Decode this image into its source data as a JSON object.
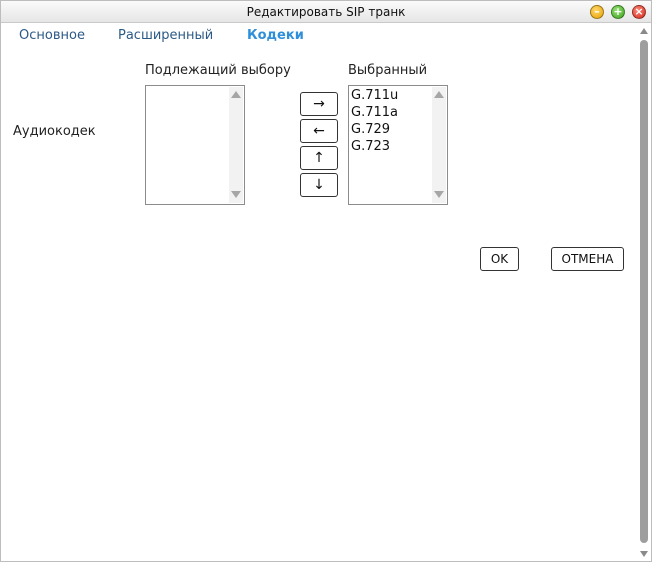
{
  "window": {
    "title": "Редактировать SIP транк",
    "controls": {
      "minimize": "–",
      "maximize": "+",
      "close": "×"
    }
  },
  "tabs": [
    {
      "label": "Основное",
      "active": false
    },
    {
      "label": "Расширенный",
      "active": false
    },
    {
      "label": "Кодеки",
      "active": true
    }
  ],
  "codecs": {
    "row_label": "Аудиокодек",
    "available_label": "Подлежащий выбору",
    "selected_label": "Выбранный",
    "available_items": [],
    "selected_items": [
      "G.711u",
      "G.711a",
      "G.729",
      "G.723"
    ]
  },
  "move_buttons": {
    "right": "→",
    "left": "←",
    "up": "↑",
    "down": "↓"
  },
  "actions": {
    "ok": "OK",
    "cancel": "ОТМЕНА"
  },
  "colors": {
    "tab_text": "#2c5a86",
    "tab_active": "#2f8fd8",
    "border": "#333333"
  }
}
